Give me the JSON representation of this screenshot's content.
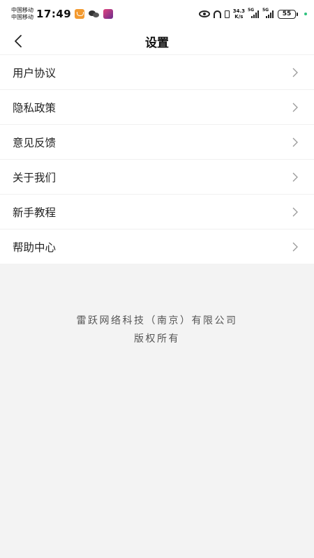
{
  "status_bar": {
    "carrier_1": "中国移动",
    "carrier_2": "中国移动",
    "time": "17:49",
    "net_speed_value": "34.3",
    "net_speed_unit": "K/s",
    "signal_1_label": "5G",
    "signal_2_label": "5G",
    "battery": "55",
    "icons": [
      "mail-app-icon",
      "wechat-icon",
      "photo-app-icon",
      "eye-icon",
      "headset-icon",
      "vibrate-icon",
      "signal-icon",
      "battery-icon"
    ]
  },
  "nav": {
    "title": "设置",
    "back_icon": "chevron-left-icon"
  },
  "menu": {
    "items": [
      {
        "label": "用户协议"
      },
      {
        "label": "隐私政策"
      },
      {
        "label": "意见反馈"
      },
      {
        "label": "关于我们"
      },
      {
        "label": "新手教程"
      },
      {
        "label": "帮助中心"
      }
    ],
    "item_icon": "chevron-right-icon"
  },
  "footer": {
    "company": "雷跃网络科技（南京）有限公司",
    "rights": "版权所有"
  },
  "colors": {
    "background": "#f3f3f3",
    "surface": "#ffffff",
    "text": "#222222",
    "footer_text": "#555555",
    "chevron": "#999999"
  }
}
